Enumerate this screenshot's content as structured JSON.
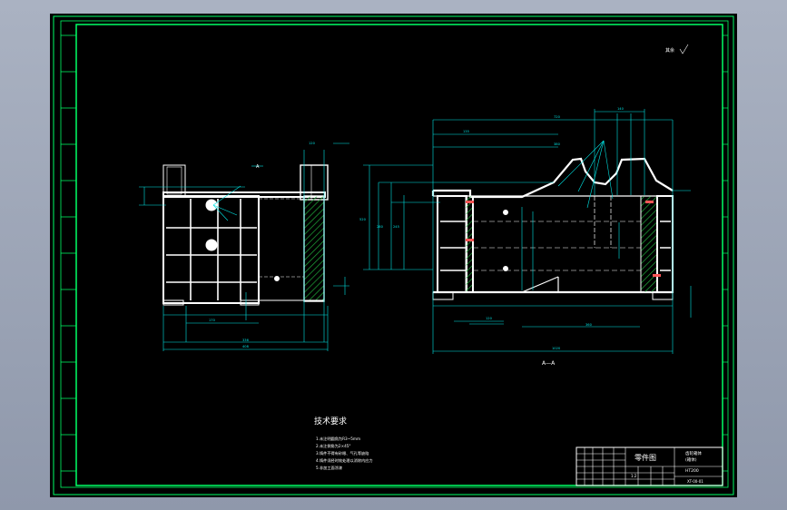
{
  "drawing": {
    "section_label": "A—A",
    "view_mark": "A",
    "surface_note": "其余",
    "tech_requirements_title": "技术要求",
    "tech_requirements": [
      "1.未注明圆角为R3~5mm",
      "2.未注倒角为2×45°",
      "3.铸件不得有砂眼、气孔等缺陷",
      "4.铸件须经时效处理以消除内应力",
      "5.非加工面涂漆"
    ]
  },
  "title_block": {
    "drawing_type": "零件图",
    "part_name": "齿轮箱体",
    "sub_name": "(箱体)",
    "material": "HT200",
    "scale": "1:2",
    "drawing_no": "XT-00-01"
  },
  "colors": {
    "sheet_bg": "#000000",
    "outline": "#ffffff",
    "dimension": "#00e5e5",
    "hatch": "#1faa3a",
    "border": "#00ff66",
    "note_text": "#ff5555"
  }
}
